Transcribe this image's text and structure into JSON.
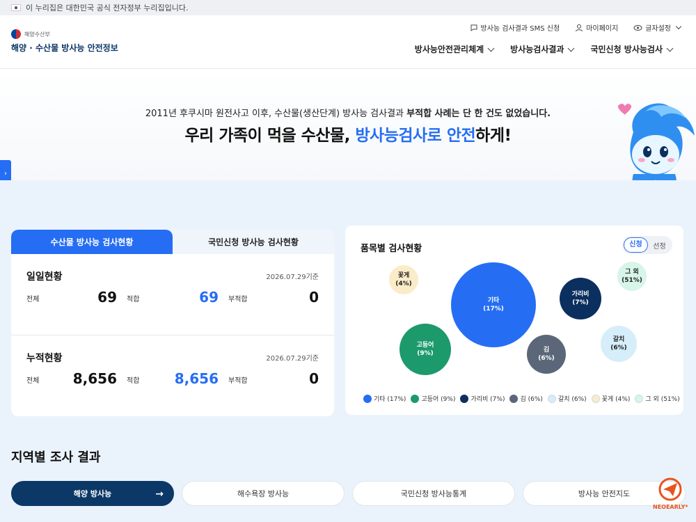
{
  "gov_banner": {
    "text": "이 누리집은 대한민국 공식 전자정부 누리집입니다."
  },
  "header": {
    "ministry": "해양수산부",
    "site_title": "해양 · 수산물 방사능 안전정보",
    "util": [
      {
        "label": "방사능 검사결과 SMS 신청"
      },
      {
        "label": "마이페이지"
      },
      {
        "label": "글자설정"
      }
    ],
    "nav": [
      {
        "label": "방사능안전관리체계"
      },
      {
        "label": "방사능검사결과"
      },
      {
        "label": "국민신청 방사능검사"
      }
    ]
  },
  "hero": {
    "subtitle_pre": "2011년 후쿠시마 원전사고 이후, 수산물(생산단계) 방사능 검사결과 ",
    "subtitle_bold": "부적합 사례는 단 한 건도 없었습니다.",
    "title_pre": "우리 가족이 먹을 수산물, ",
    "title_accent": "방사능검사로 안전",
    "title_post": "하게!"
  },
  "side_tab": {
    "glyph": "›"
  },
  "stats": {
    "tabs": [
      {
        "label": "수산물 방사능 검사현황"
      },
      {
        "label": "국민신청 방사능 검사현황"
      }
    ],
    "daily": {
      "title": "일일현황",
      "date": "2026.07.29기준",
      "total_label": "전체",
      "total": "69",
      "pass_label": "적합",
      "pass": "69",
      "fail_label": "부적합",
      "fail": "0"
    },
    "cumulative": {
      "title": "누적현황",
      "date": "2026.07.29기준",
      "total_label": "전체",
      "total": "8,656",
      "pass_label": "적합",
      "pass": "8,656",
      "fail_label": "부적합",
      "fail": "0"
    }
  },
  "items_chart": {
    "title": "품목별 검사현황",
    "toggle": {
      "on": "신청",
      "off": "선정"
    }
  },
  "chart_data": {
    "type": "pie",
    "categories": [
      "기타",
      "고등어",
      "가리비",
      "김",
      "갈치",
      "꽃게",
      "그 외"
    ],
    "values": [
      17,
      9,
      7,
      6,
      6,
      4,
      51
    ],
    "labels": [
      "기타\n(17%)",
      "고등어\n(9%)",
      "가리비\n(7%)",
      "김\n(6%)",
      "갈치\n(6%)",
      "꽃게\n(4%)",
      "그 외\n(51%)"
    ],
    "legend": [
      "기타 (17%)",
      "고등어 (9%)",
      "가리비 (7%)",
      "김 (6%)",
      "갈치 (6%)",
      "꽃게 (4%)",
      "그 외 (51%)"
    ],
    "colors": [
      "#256ef4",
      "#1c9a6b",
      "#0b2f5e",
      "#5b6779",
      "#d6edfa",
      "#fbecc9",
      "#d7f5e9"
    ],
    "text_colors": [
      "#ffffff",
      "#ffffff",
      "#ffffff",
      "#ffffff",
      "#222222",
      "#222222",
      "#222222"
    ]
  },
  "region": {
    "title": "지역별 조사 결과",
    "buttons": [
      {
        "label": "해양 방사능"
      },
      {
        "label": "해수욕장 방사능"
      },
      {
        "label": "국민신청 방사능통계"
      },
      {
        "label": "방사능 안전지도"
      }
    ],
    "arrow": "→"
  },
  "brand": {
    "name": "NEOEARLY*"
  }
}
